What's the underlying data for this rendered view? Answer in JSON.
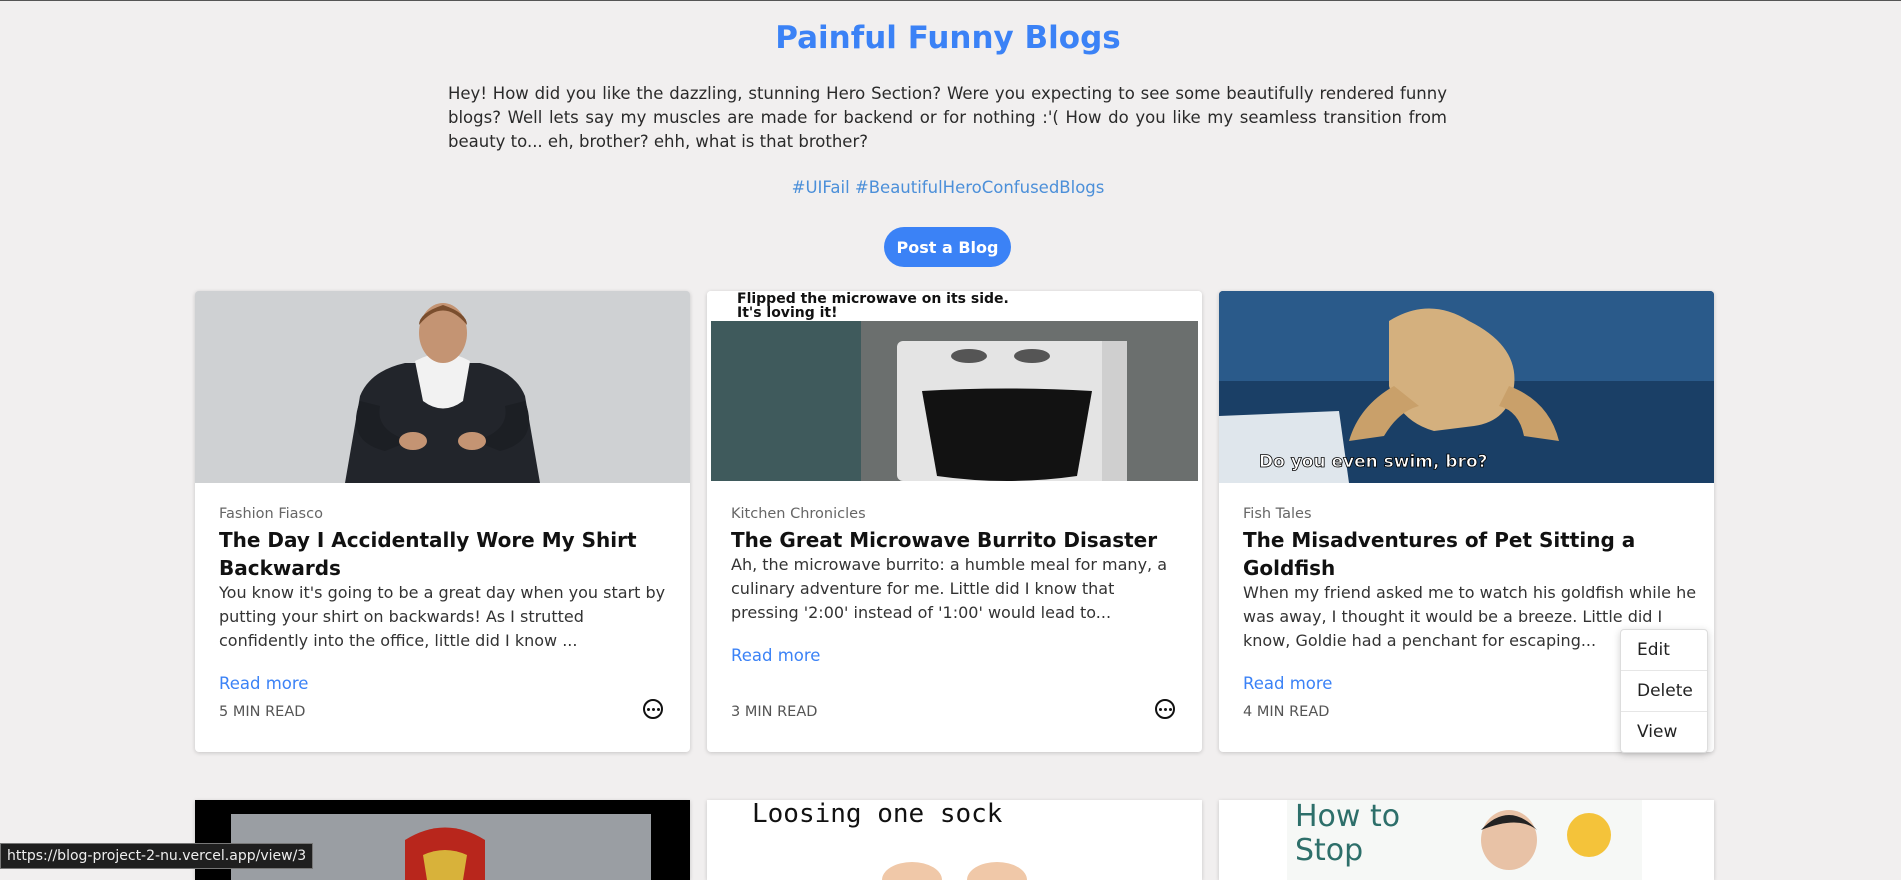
{
  "page": {
    "title": "Painful Funny Blogs",
    "intro": "Hey! How did you like the dazzling, stunning Hero Section? Were you expecting to see some beautifully rendered funny blogs? Well lets say my muscles are made for backend or for nothing :'( How do you like my seamless transition from beauty to... eh, brother? ehh, what is that brother?",
    "hashtags": "#UIFail #BeautifulHeroConfusedBlogs",
    "post_button": "Post a Blog"
  },
  "cards": [
    {
      "category": "Fashion Fiasco",
      "title": "The Day I Accidentally Wore My Shirt Backwards",
      "excerpt": "You know it's going to be a great day when you start by putting your shirt on backwards! As I strutted confidently into the office, little did I know ...",
      "read_more": "Read more",
      "read_time": "5 MIN READ",
      "image_icon": "man-in-suit-backwards-image"
    },
    {
      "category": "Kitchen Chronicles",
      "title": "The Great Microwave Burrito Disaster",
      "excerpt": "Ah, the microwave burrito: a humble meal for many, a culinary adventure for me. Little did I know that pressing '2:00' instead of '1:00' would lead to...",
      "read_more": "Read more",
      "read_time": "3 MIN READ",
      "image_caption": "Flipped the microwave on its side. It's loving it!"
    },
    {
      "category": "Fish Tales",
      "title": "The Misadventures of Pet Sitting a Goldfish",
      "excerpt": "When my friend asked me to watch his goldfish while he was away, I thought it would be a breeze. Little did I know, Goldie had a penchant for escaping...",
      "read_more": "Read more",
      "read_time": "4 MIN READ",
      "image_caption": "Do you even swim, bro?"
    }
  ],
  "context_menu": {
    "items": [
      "Edit",
      "Delete",
      "View"
    ]
  },
  "next_row": [
    {
      "image_icon": "iron-man-helmet-image"
    },
    {
      "image_caption": "Loosing one sock"
    },
    {
      "image_caption": "How to Stop"
    }
  ],
  "status_bar": {
    "url": "https://blog-project-2-nu.vercel.app/view/3"
  },
  "colors": {
    "accent": "#3b82f6",
    "background": "#f1efef",
    "card": "#ffffff"
  }
}
